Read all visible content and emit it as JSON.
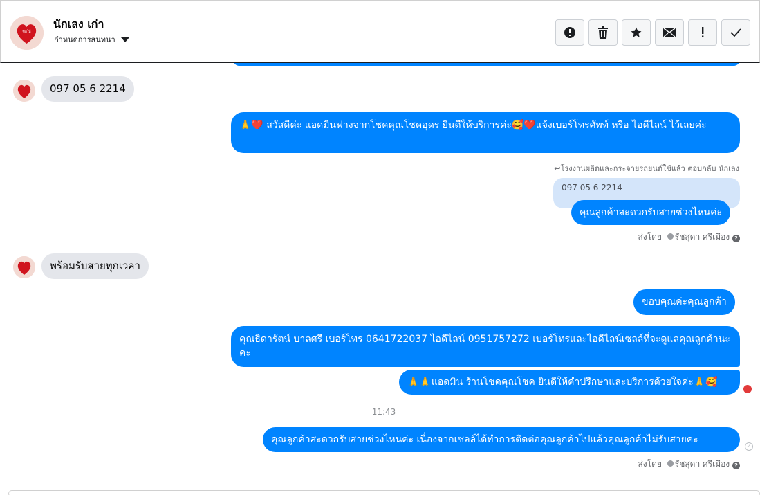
{
  "header": {
    "contact_name": "นักเลง เก่า",
    "subtitle": "กำหนดการสนทนา",
    "actions": [
      {
        "name": "report-button",
        "icon": "alert-circle-icon"
      },
      {
        "name": "delete-button",
        "icon": "trash-icon"
      },
      {
        "name": "star-button",
        "icon": "star-icon"
      },
      {
        "name": "mark-unread-button",
        "icon": "envelope-icon"
      },
      {
        "name": "spam-button",
        "icon": "exclamation-icon"
      },
      {
        "name": "done-button",
        "icon": "check-icon"
      }
    ]
  },
  "messages": {
    "m1": "097 05 6 2214",
    "m2": "🙏❤️ สวัสดีค่ะ แอดมินฟางจากโชคคุณโชคอุดร ยินดีให้บริการค่ะ🥰❤️แจ้งเบอร์โทรศัพท์ หรือ ไอดีไลน์  ไว้เลยค่ะ",
    "reply_label": "↩โรงงานผลิตและกระจายรถยนต์ใช้แล้ว ตอบกลับ นักเลง",
    "quoted": "097 05 6 2214",
    "m3": "คุณลูกค้าสะดวกรับสายช่วงไหนค่ะ",
    "sent_by_1": "ส่งโดย",
    "agent_1": "รัชสุดา ศรีเมือง",
    "m4": "พร้อมรับสายทุกเวลา",
    "m5": "ขอบคุณค่ะคุณลูกค้า",
    "m6": "คุณธิดารัตน์ บาลศรี เบอร์โทร 0641722037  ไอดีไลน์ 0951757272   เบอร์โทรและไอดีไลน์เซลล์ที่จะดูแลคุณลูกค้านะคะ",
    "m7": "🙏🙏แอดมิน ร้านโชคคุณโชค ยินดีให้คำปรึกษาและบริการด้วยใจค่ะ🙏🥰",
    "time": "11:43",
    "m8": "คุณลูกค้าสะดวกรับสายช่วงไหนค่ะ  เนื่องจากเซลล์ได้ทำการติดต่อคุณลูกค้าไปแล้วคุณลูกค้าไม่รับสายค่ะ",
    "sent_by_2": "ส่งโดย",
    "agent_2": "รัชสุดา ศรีเมือง"
  },
  "colors": {
    "outgoing": "#0084ff",
    "incoming": "#e4e6eb",
    "quote": "#d4e5fa"
  }
}
